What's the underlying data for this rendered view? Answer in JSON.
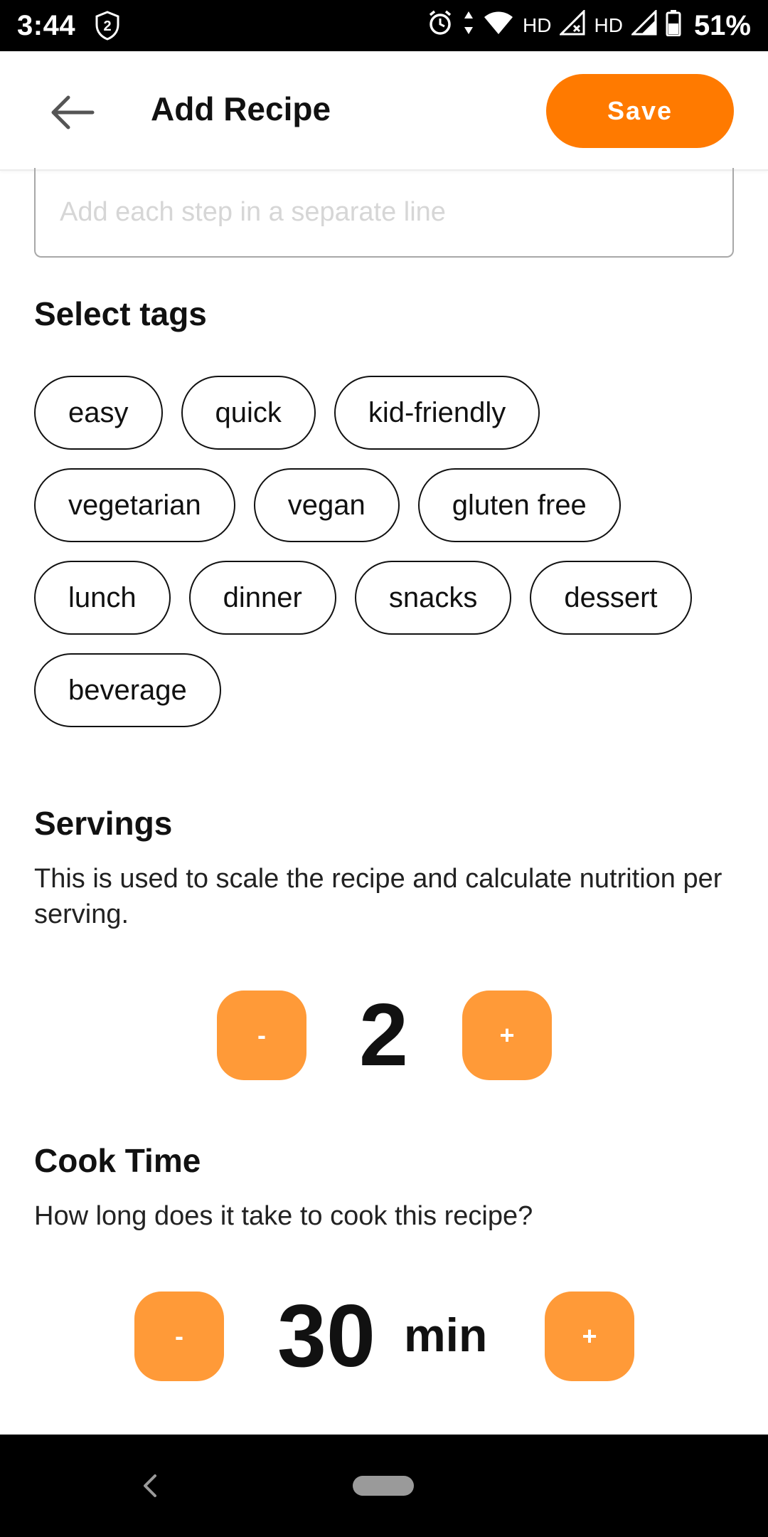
{
  "status_bar": {
    "time": "3:44",
    "notification_badge": "2",
    "wifi_label": "HD",
    "signal_label": "HD",
    "battery_percent": "51%",
    "icons": [
      "shield-badge-icon",
      "alarm-icon",
      "data-arrows-icon",
      "wifi-icon",
      "signal-x-icon",
      "signal-icon",
      "battery-icon"
    ]
  },
  "app_bar": {
    "title": "Add Recipe",
    "save_label": "Save",
    "accent_color": "#ff7a00"
  },
  "steps_input": {
    "placeholder": "Add each step in a separate line",
    "value": ""
  },
  "tags_section": {
    "title": "Select tags",
    "rows": [
      [
        "easy",
        "quick",
        "kid-friendly"
      ],
      [
        "vegetarian",
        "vegan",
        "gluten free"
      ],
      [
        "lunch",
        "dinner",
        "snacks",
        "dessert"
      ],
      [
        "beverage"
      ]
    ]
  },
  "servings_section": {
    "title": "Servings",
    "description": "This is used to scale the recipe and calculate nutrition per serving.",
    "decrement_label": "-",
    "value": "2",
    "increment_label": "+",
    "button_color": "#ff9a38"
  },
  "cook_time_section": {
    "title": "Cook Time",
    "description": "How long does it take to cook this recipe?",
    "decrement_label": "-",
    "value": "30",
    "unit": "min",
    "increment_label": "+"
  },
  "nav_bar": {
    "icons": [
      "back-nav-icon",
      "home-pill-icon"
    ]
  }
}
